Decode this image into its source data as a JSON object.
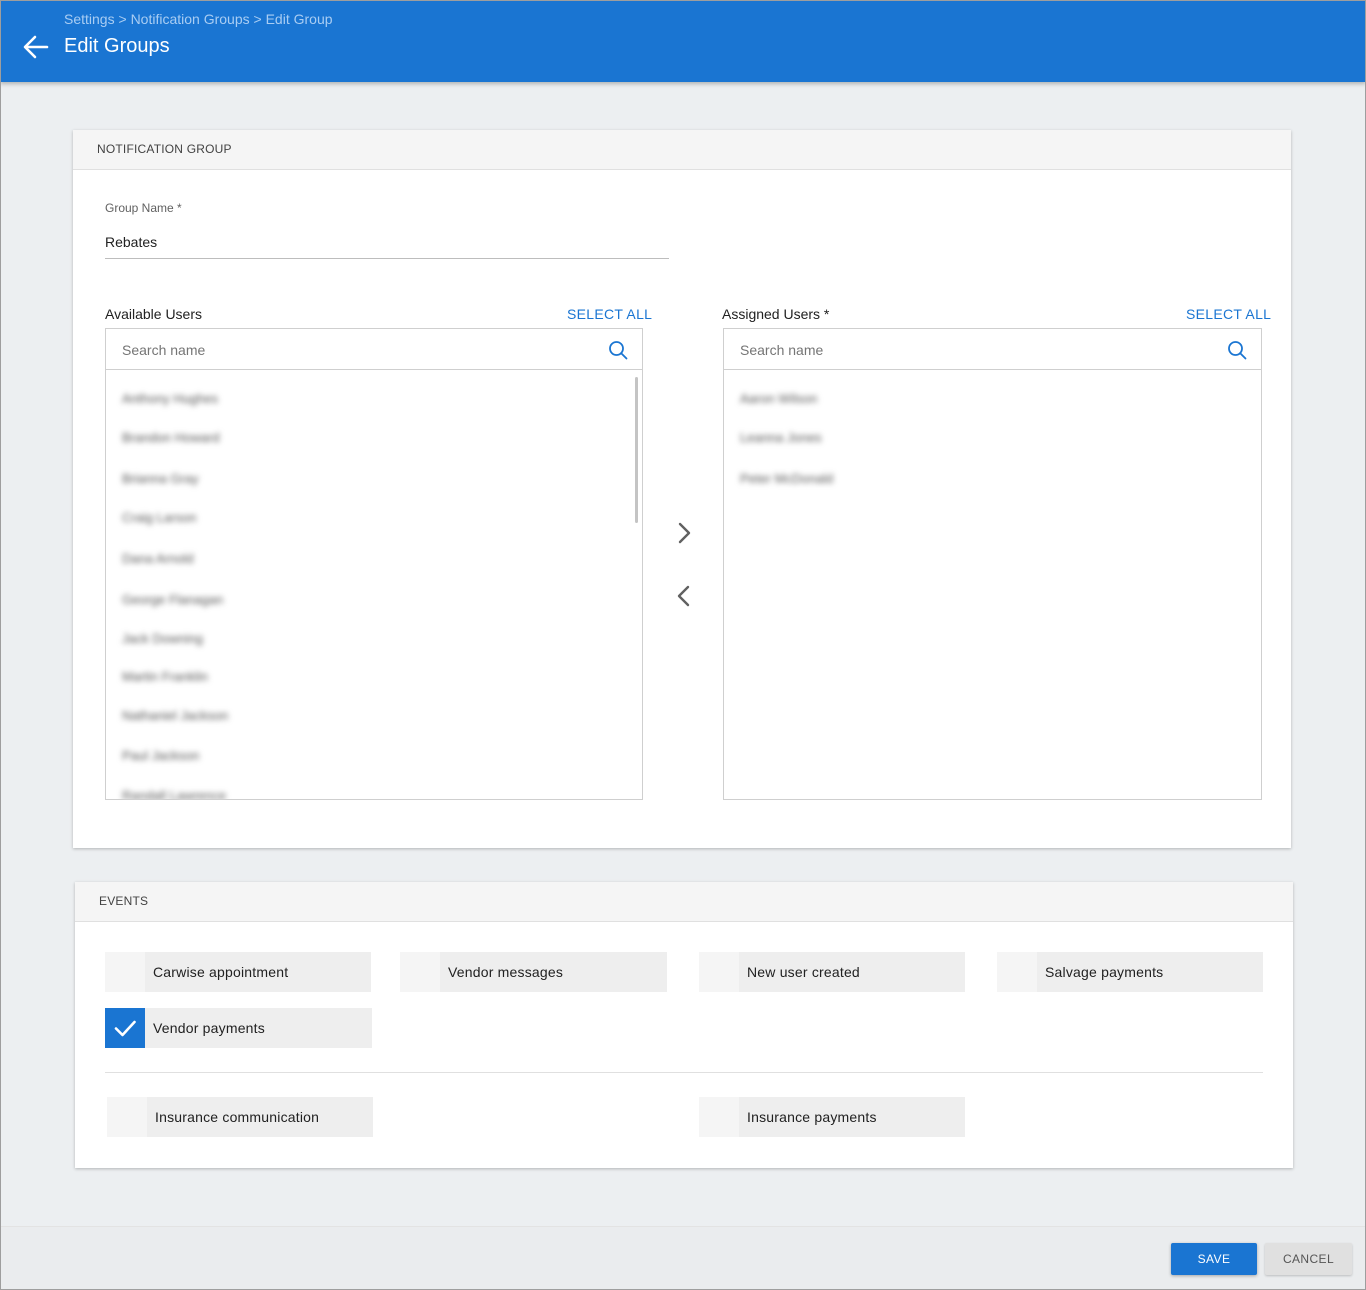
{
  "header": {
    "breadcrumb": [
      "Settings",
      "Notification Groups",
      "Edit Group"
    ],
    "breadcrumb_separator": ">",
    "title": "Edit Groups",
    "back_icon": "arrow-left-icon"
  },
  "notification_group": {
    "section_title": "NOTIFICATION GROUP",
    "group_name": {
      "label": "Group Name *",
      "value": "Rebates"
    },
    "available_users": {
      "title": "Available Users",
      "select_all": "SELECT ALL",
      "search_placeholder": "Search name",
      "items": [
        "Anthony Hughes",
        "Brandon Howard",
        "Brianna Gray",
        "Craig Larson",
        "Dana Arnold",
        "George Flanagan",
        "Jack Downing",
        "Martin Franklin",
        "Nathaniel Jackson",
        "Paul Jackson",
        "Randall Lawrence"
      ]
    },
    "assigned_users": {
      "title": "Assigned Users *",
      "select_all": "SELECT ALL",
      "search_placeholder": "Search name",
      "items": [
        "Aaron Wilson",
        "Leanna Jones",
        "Peter McDonald"
      ]
    },
    "move_right_icon": "chevron-right-icon",
    "move_left_icon": "chevron-left-icon"
  },
  "events": {
    "section_title": "EVENTS",
    "items": [
      {
        "label": "Carwise appointment",
        "checked": false
      },
      {
        "label": "Vendor messages",
        "checked": false
      },
      {
        "label": "New user created",
        "checked": false
      },
      {
        "label": "Salvage payments",
        "checked": false
      },
      {
        "label": "Vendor payments",
        "checked": true
      },
      {
        "label": "Insurance communication",
        "checked": false
      },
      {
        "label": "Insurance payments",
        "checked": false
      }
    ]
  },
  "footer": {
    "save_label": "SAVE",
    "cancel_label": "CANCEL"
  },
  "colors": {
    "primary": "#1a75d2",
    "page_background": "#eceff1"
  }
}
